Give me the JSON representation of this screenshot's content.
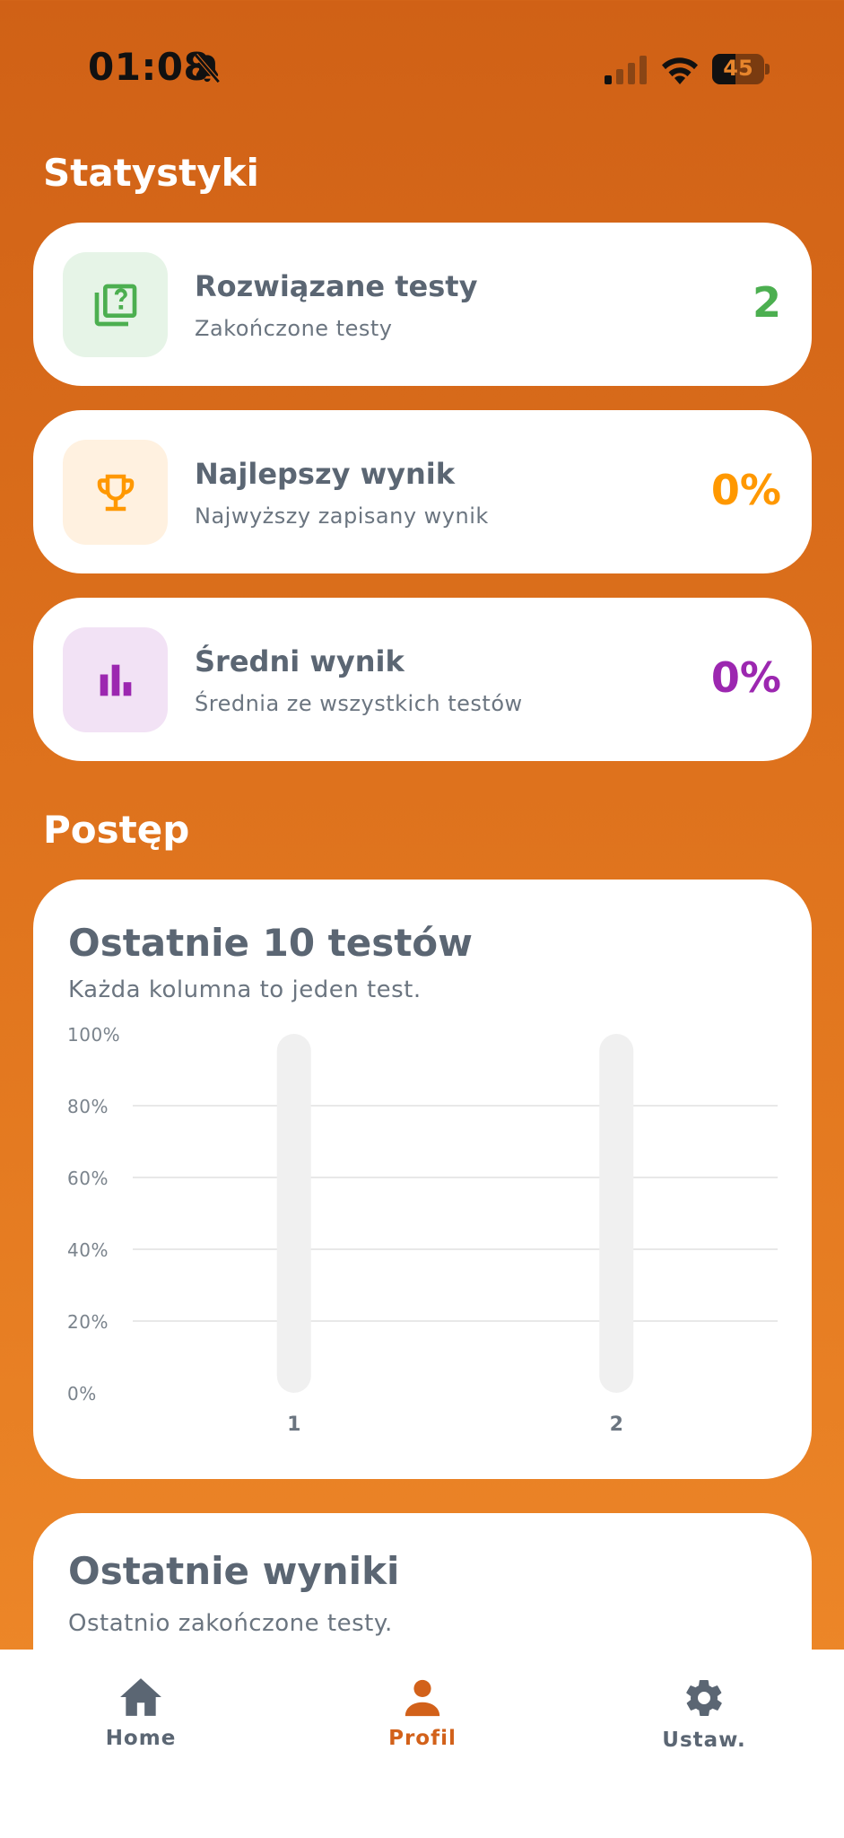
{
  "status_bar": {
    "time": "01:08",
    "battery": "45",
    "battery_level": 0.45
  },
  "sections": {
    "statistics": "Statystyki",
    "progress": "Postęp"
  },
  "stats": [
    {
      "title": "Rozwiązane testy",
      "subtitle": "Zakończone testy",
      "value": "2",
      "color": "#4CAF50",
      "icon": "quiz-icon",
      "icon_bg": "#E6F4E7"
    },
    {
      "title": "Najlepszy wynik",
      "subtitle": "Najwyższy zapisany wynik",
      "value": "0%",
      "color": "#FF9800",
      "icon": "trophy-icon",
      "icon_bg": "#FFF1E0"
    },
    {
      "title": "Średni wynik",
      "subtitle": "Średnia ze wszystkich testów",
      "value": "0%",
      "color": "#9C27B0",
      "icon": "bar-chart-icon",
      "icon_bg": "#F2E2F5"
    }
  ],
  "chart_card": {
    "title": "Ostatnie 10 testów",
    "subtitle": "Każda kolumna to jeden test."
  },
  "chart_data": {
    "type": "bar",
    "categories": [
      "1",
      "2"
    ],
    "values": [
      0,
      0
    ],
    "ylim": [
      0,
      100
    ],
    "yticks": [
      "0%",
      "20%",
      "40%",
      "60%",
      "80%",
      "100%"
    ],
    "grid": true
  },
  "results_card": {
    "title": "Ostatnie wyniki",
    "subtitle": "Ostatnio zakończone testy."
  },
  "nav": [
    {
      "label": "Home",
      "icon": "home-icon",
      "active": false
    },
    {
      "label": "Profil",
      "icon": "person-icon",
      "active": true
    },
    {
      "label": "Ustaw.",
      "icon": "gear-icon",
      "active": false
    }
  ],
  "colors": {
    "accent": "#D2611A",
    "nav_inactive": "#5B6673",
    "track": "#F0F0F0",
    "grid": "#E8E8E8"
  }
}
